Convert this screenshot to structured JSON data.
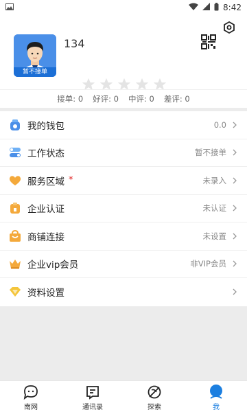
{
  "statusbar": {
    "time": "8:42",
    "icons": [
      "image-icon",
      "wifi-icon",
      "signal-icon",
      "battery-icon"
    ]
  },
  "header": {
    "avatar_badge": "暂不接单",
    "username": "134",
    "stars_total": 5,
    "rating": 0
  },
  "stats": [
    {
      "label": "接单: ",
      "value": "0"
    },
    {
      "label": "好评: ",
      "value": "0"
    },
    {
      "label": "中评: ",
      "value": "0"
    },
    {
      "label": "差评: ",
      "value": "0"
    }
  ],
  "menu": [
    {
      "label": "我的钱包",
      "value": "0.0",
      "icon": "wallet-icon"
    },
    {
      "label": "工作状态",
      "value": "暂不接单",
      "icon": "toggle-icon"
    },
    {
      "label": "服务区域",
      "value": "未录入",
      "icon": "heart-icon",
      "required": "*"
    },
    {
      "label": "企业认证",
      "value": "未认证",
      "icon": "enterprise-icon"
    },
    {
      "label": "商铺连接",
      "value": "未设置",
      "icon": "shop-icon"
    },
    {
      "label": "企业vip会员",
      "value": "非VIP会员",
      "icon": "crown-icon"
    },
    {
      "label": "资料设置",
      "value": "",
      "icon": "diamond-icon"
    }
  ],
  "tabs": [
    {
      "label": "南网",
      "icon": "chat-icon"
    },
    {
      "label": "通讯录",
      "icon": "contacts-icon"
    },
    {
      "label": "探索",
      "icon": "explore-icon"
    },
    {
      "label": "我",
      "icon": "profile-icon",
      "active": true
    }
  ],
  "colors": {
    "accent": "#1c7fe0",
    "orange": "#f4a93b",
    "blue": "#4a8fe8",
    "required": "#e02020"
  }
}
